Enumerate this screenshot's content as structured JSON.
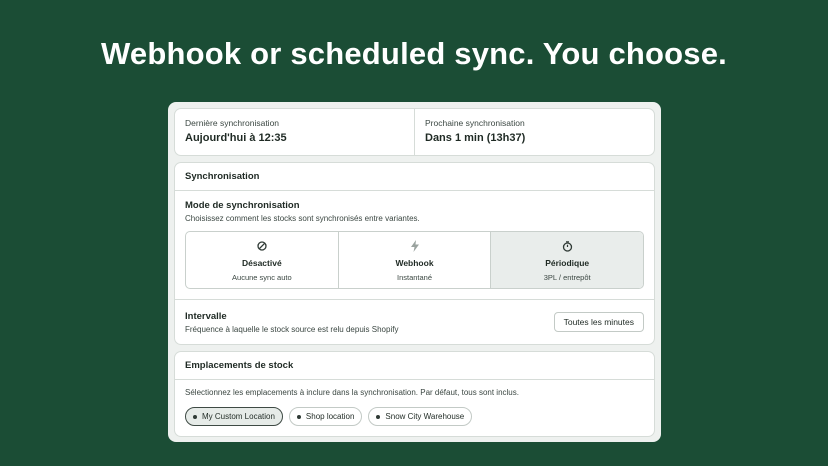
{
  "headline": "Webhook or scheduled sync. You choose.",
  "status": {
    "last_label": "Dernière synchronisation",
    "last_value": "Aujourd'hui à 12:35",
    "next_label": "Prochaine synchronisation",
    "next_value": "Dans 1 min (13h37)"
  },
  "sync": {
    "heading": "Synchronisation",
    "mode_title": "Mode de synchronisation",
    "mode_desc": "Choisissez comment les stocks sont synchronisés entre variantes.",
    "options": [
      {
        "icon": "disabled-icon",
        "label": "Désactivé",
        "sub": "Aucune sync auto",
        "active": false
      },
      {
        "icon": "lightning-icon",
        "label": "Webhook",
        "sub": "Instantané",
        "active": false
      },
      {
        "icon": "clock-icon",
        "label": "Périodique",
        "sub": "3PL / entrepôt",
        "active": true
      }
    ],
    "interval_title": "Intervalle",
    "interval_desc": "Fréquence à laquelle le stock source est relu depuis Shopify",
    "interval_button": "Toutes les minutes"
  },
  "locations": {
    "heading": "Emplacements de stock",
    "desc": "Sélectionnez les emplacements à inclure dans la synchronisation. Par défaut, tous sont inclus.",
    "chips": [
      {
        "label": "My Custom Location",
        "selected": true
      },
      {
        "label": "Shop location",
        "selected": false
      },
      {
        "label": "Snow City Warehouse",
        "selected": false
      }
    ]
  },
  "colors": {
    "background": "#1b4d35",
    "active_option": "#e9edeb"
  }
}
